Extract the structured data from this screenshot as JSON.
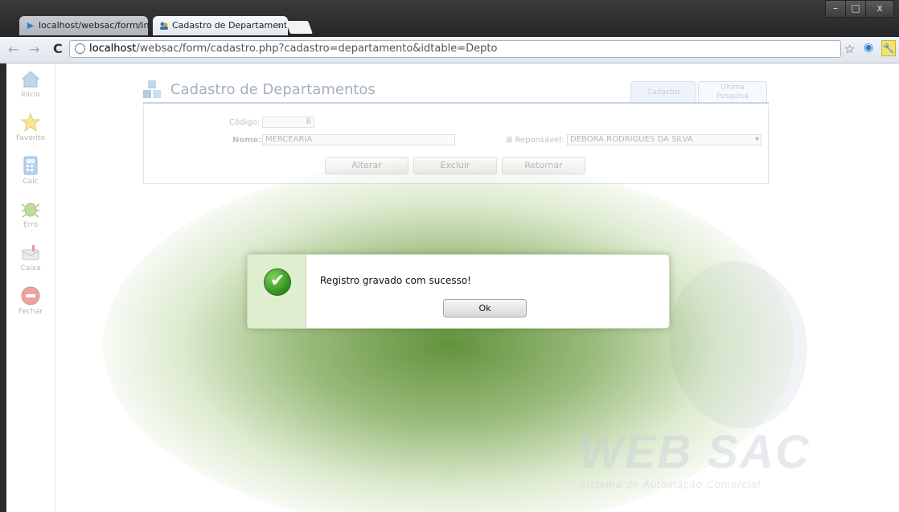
{
  "browser": {
    "tabs": [
      {
        "label": "localhost/websac/form/ind"
      },
      {
        "label": "Cadastro de Departamento"
      }
    ],
    "address": {
      "host": "localhost",
      "path": "/websac/form/cadastro.php?cadastro=departamento&idtable=Depto"
    },
    "window_controls": {
      "minimize": "–",
      "maximize": "□",
      "close": "x"
    }
  },
  "sidebar": {
    "items": [
      {
        "label": "Inicio",
        "icon": "home-icon"
      },
      {
        "label": "Favorito",
        "icon": "star-icon"
      },
      {
        "label": "Calc",
        "icon": "calculator-icon"
      },
      {
        "label": "Erro",
        "icon": "bug-icon"
      },
      {
        "label": "Caixa",
        "icon": "mailbox-icon"
      },
      {
        "label": "Fechar",
        "icon": "close-icon"
      }
    ]
  },
  "page": {
    "title": "Cadastro de Departamentos",
    "tabs": {
      "cadastro": "Cadastro",
      "ultima_line1": "Última",
      "ultima_line2": "Pesquisa"
    },
    "form": {
      "codigo_label": "Código:",
      "codigo_value": "6",
      "nome_label": "Nome:",
      "nome_value": "MERCEARIA",
      "responsavel_label": "Reponsável:",
      "responsavel_value": "DEBORA RODRIGUES DA SILVA"
    },
    "buttons": {
      "alterar": "Alterar",
      "excluir": "Excluir",
      "retornar": "Retornar"
    },
    "watermark": {
      "brand": "WEB SAC",
      "tagline": "Sistema de Automação Comercial"
    }
  },
  "dialog": {
    "message": "Registro gravado com sucesso!",
    "ok_label": "Ok",
    "icon": "success-check-icon"
  },
  "colors": {
    "accent_green": "#2e8c1c",
    "title_blue": "#26466d"
  }
}
